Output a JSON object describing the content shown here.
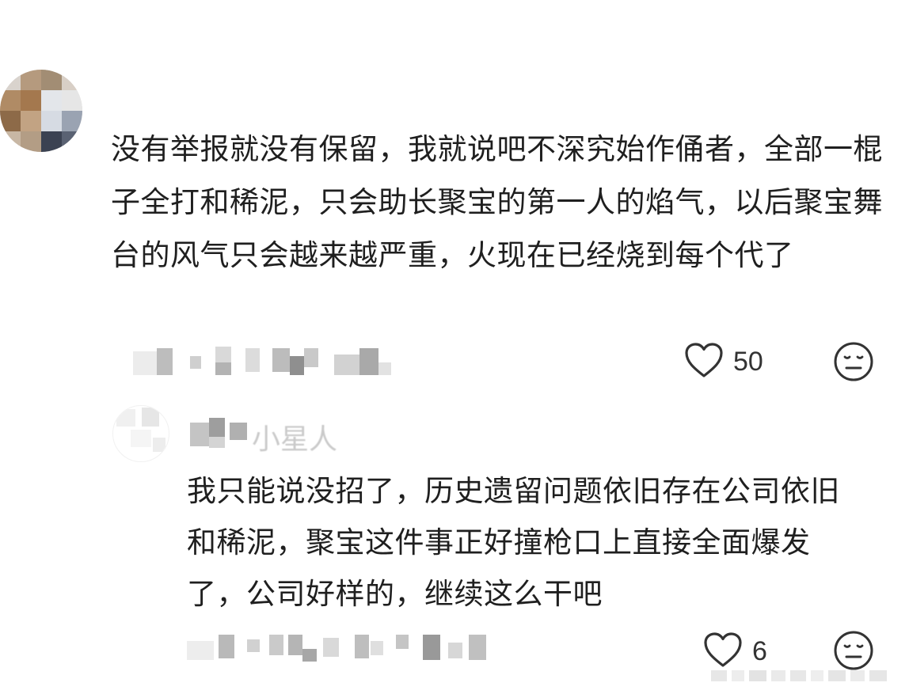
{
  "comment": {
    "text": "没有举报就没有保留，我就说吧不深究始作俑者，全部一棍子全打和稀泥，只会助长聚宝的第一人的焰气，以后聚宝舞台的风气只会越来越严重，火现在已经烧到每个代了",
    "likes": "50",
    "like_icon": "heart-outline-icon",
    "dislike_icon": "meh-face-icon"
  },
  "reply": {
    "username_visible": "小星人",
    "text": "我只能说没招了，历史遗留问题依旧存在公司依旧和稀泥，聚宝这件事正好撞枪口上直接全面爆发了，公司好样的，继续这么干吧",
    "likes": "6",
    "like_icon": "heart-outline-icon",
    "dislike_icon": "meh-face-icon"
  },
  "colors": {
    "text": "#1f1f1f",
    "icon": "#333333",
    "background": "#ffffff"
  }
}
